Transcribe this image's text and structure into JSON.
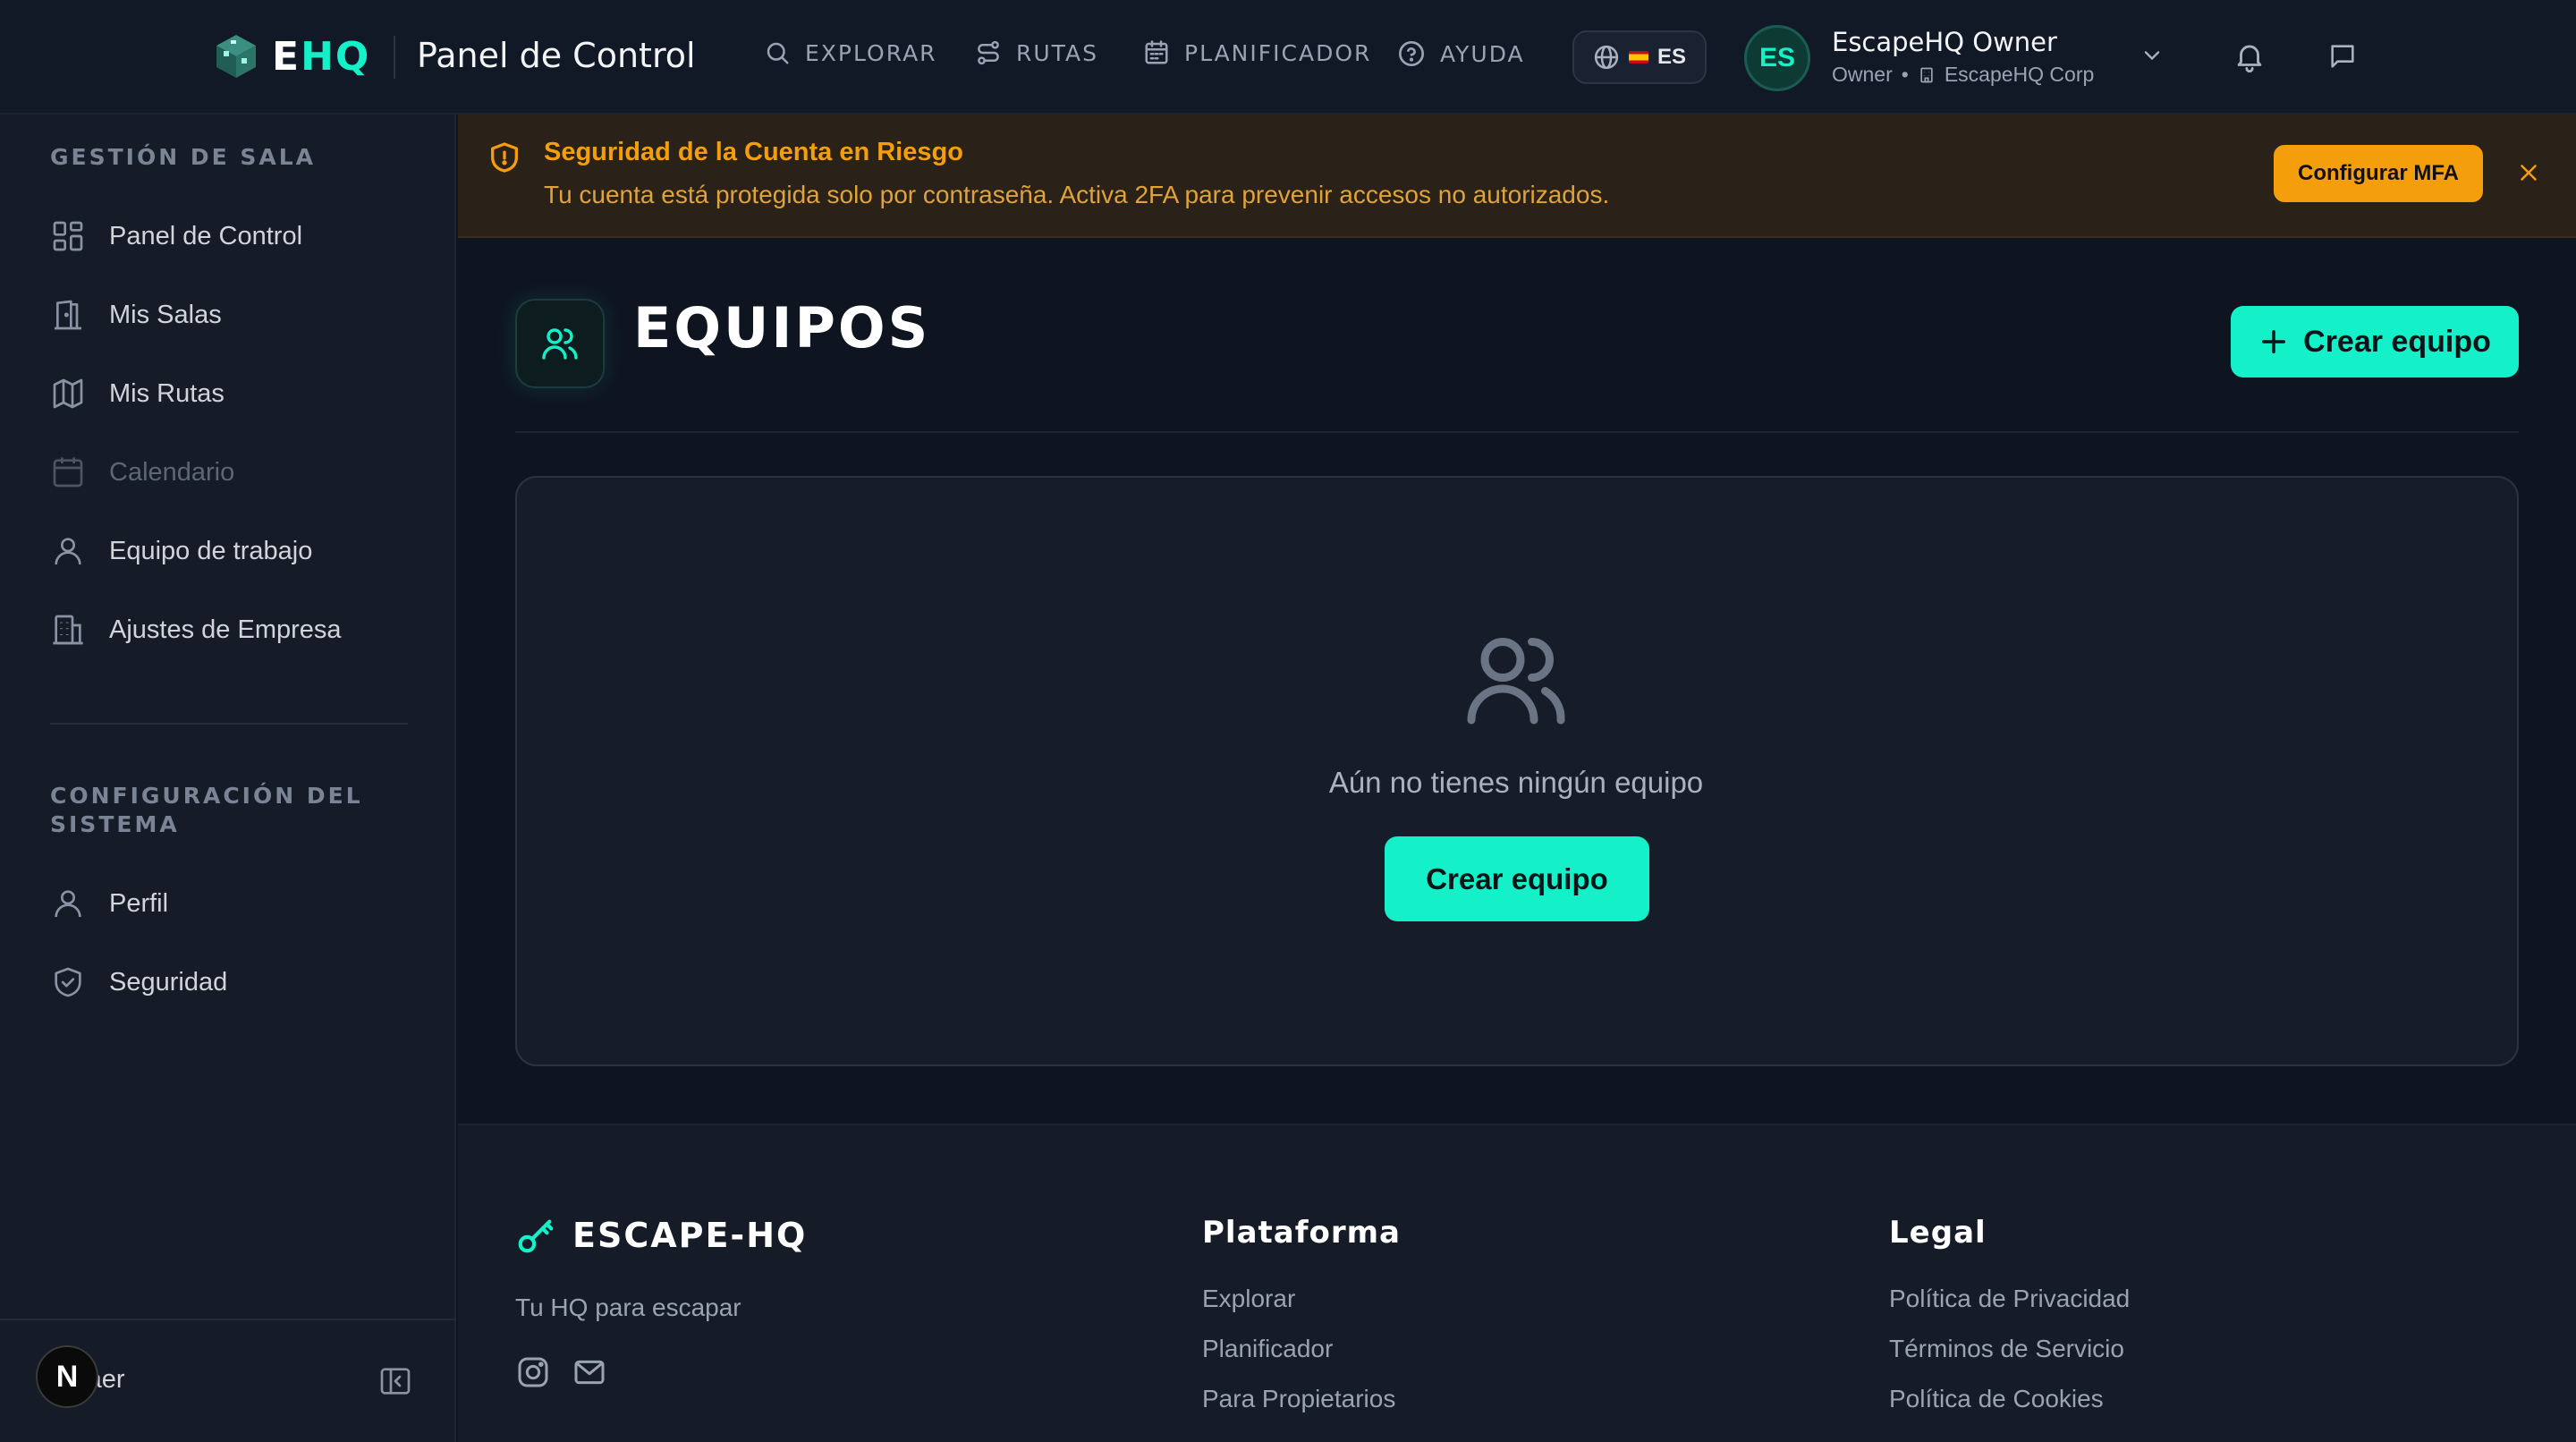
{
  "header": {
    "logo_e": "E",
    "logo_hq": "HQ",
    "title": "Panel de Control",
    "nav": [
      {
        "label": "EXPLORAR",
        "icon": "search-icon"
      },
      {
        "label": "RUTAS",
        "icon": "route-icon"
      },
      {
        "label": "PLANIFICADOR",
        "icon": "calendar-icon"
      },
      {
        "label": "AYUDA",
        "icon": "help-icon"
      }
    ],
    "language": "ES",
    "user": {
      "initials": "ES",
      "name": "EscapeHQ Owner",
      "role": "Owner",
      "company": "EscapeHQ Corp"
    }
  },
  "sidebar": {
    "section1_title": "GESTIÓN DE SALA",
    "section1_items": [
      {
        "label": "Panel de Control",
        "icon": "dashboard-icon"
      },
      {
        "label": "Mis Salas",
        "icon": "door-icon"
      },
      {
        "label": "Mis Rutas",
        "icon": "map-icon"
      },
      {
        "label": "Calendario",
        "icon": "calendar-icon",
        "disabled": true
      },
      {
        "label": "Equipo de trabajo",
        "icon": "user-icon"
      },
      {
        "label": "Ajustes de Empresa",
        "icon": "building-icon"
      }
    ],
    "section2_title": "CONFIGURACIÓN DEL SISTEMA",
    "section2_items": [
      {
        "label": "Perfil",
        "icon": "user-icon"
      },
      {
        "label": "Seguridad",
        "icon": "shield-icon"
      }
    ],
    "collapse_label": "raer",
    "badge": "N"
  },
  "alert": {
    "title": "Seguridad de la Cuenta en Riesgo",
    "text": "Tu cuenta está protegida solo por contraseña. Activa 2FA para prevenir accesos no autorizados.",
    "button": "Configurar MFA"
  },
  "main": {
    "title": "EQUIPOS",
    "create_button": "Crear equipo",
    "empty_text": "Aún no tienes ningún equipo",
    "empty_button": "Crear equipo"
  },
  "footer": {
    "brand": "ESCAPE-HQ",
    "tagline": "Tu HQ para escapar",
    "platform_title": "Plataforma",
    "platform_links": [
      "Explorar",
      "Planificador",
      "Para Propietarios"
    ],
    "legal_title": "Legal",
    "legal_links": [
      "Política de Privacidad",
      "Términos de Servicio",
      "Política de Cookies"
    ]
  },
  "colors": {
    "accent": "#14f0c8",
    "warning": "#f59e0b",
    "background": "#0f1520"
  }
}
